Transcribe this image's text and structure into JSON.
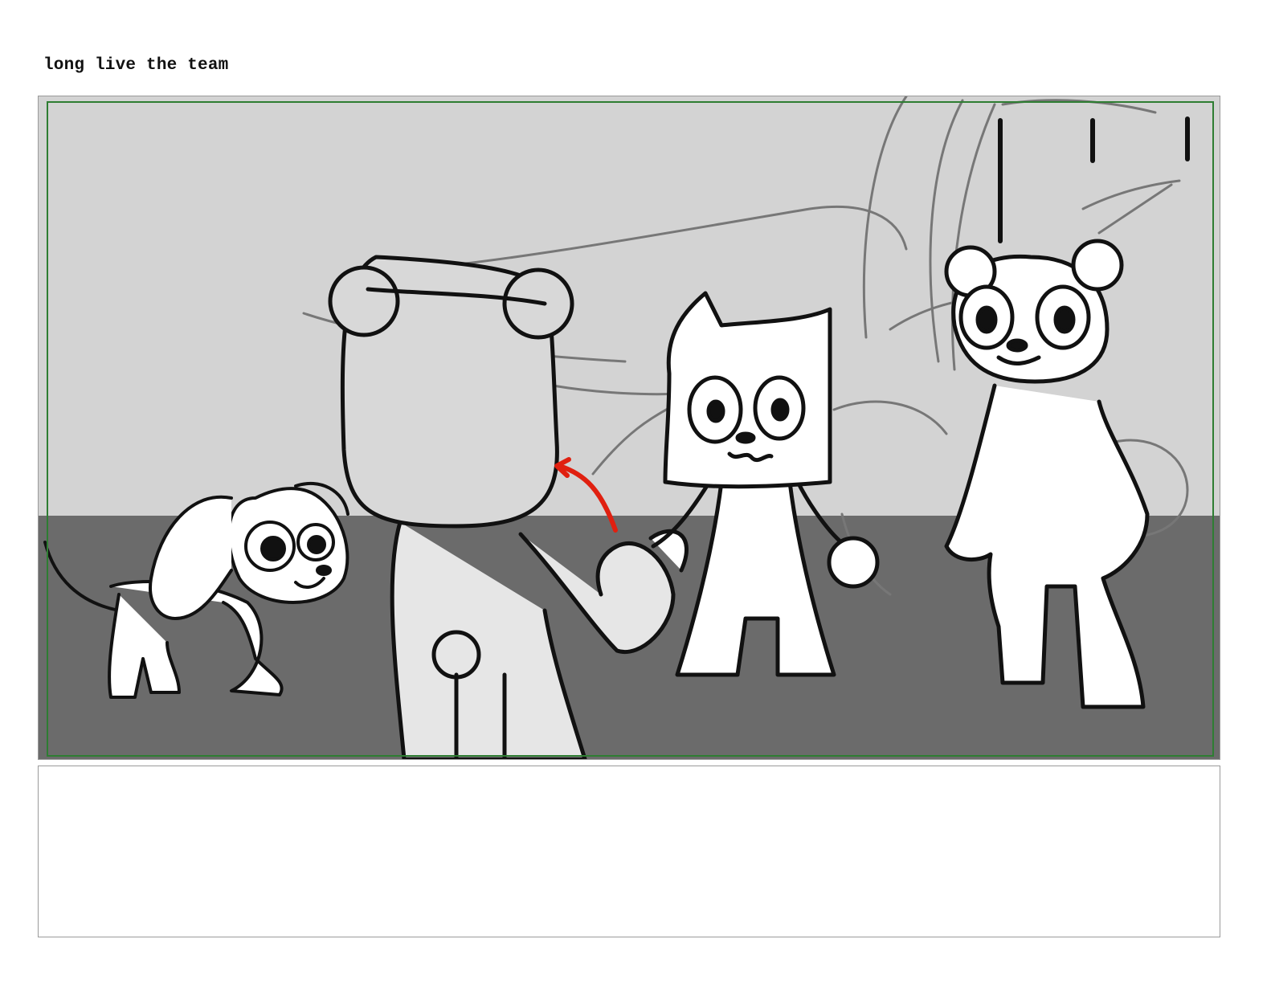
{
  "storyboard": {
    "scene_title": "long live the team",
    "notes_text": "",
    "colors": {
      "wall": "#d3d3d3",
      "floor": "#6b6b6b",
      "safe_frame": "#2e7d32",
      "ink": "#111111",
      "sketch": "#777777",
      "action_arrow": "#e02010"
    },
    "characters": [
      "puppy-character",
      "bear-character-back-view",
      "cat-character",
      "ferret-character"
    ]
  }
}
